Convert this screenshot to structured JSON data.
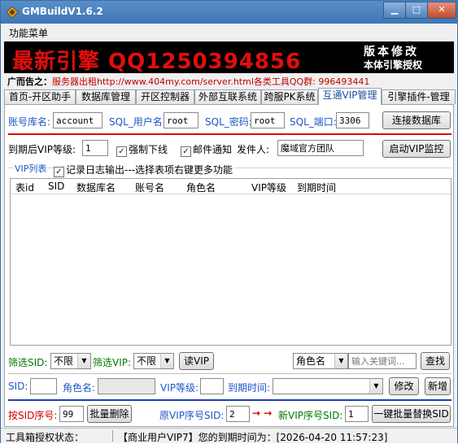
{
  "window": {
    "title": "GMBuildV1.6.2",
    "menu": "功能菜单"
  },
  "banner": {
    "left_text": "最新引擎 QQ1250394856",
    "right_line1": "版本修改",
    "right_line2": "本体引擎授权"
  },
  "ad": {
    "label": "广而告之：",
    "text": "服务器出租http://www.404my.com/server.html各类工具QQ群: 996493441"
  },
  "tabs": [
    {
      "label": "首页-开区助手"
    },
    {
      "label": "数据库管理"
    },
    {
      "label": "开区控制器"
    },
    {
      "label": "外部互联系统"
    },
    {
      "label": "跨服PK系统"
    },
    {
      "label": "互通VIP管理"
    },
    {
      "label": "引擎插件-管理"
    }
  ],
  "db": {
    "account_db_label": "账号库名:",
    "account_db_value": "account",
    "sql_user_label": "SQL_用户名:",
    "sql_user_value": "root",
    "sql_pwd_label": "SQL_密码:",
    "sql_pwd_value": "root",
    "sql_port_label": "SQL_端口:",
    "sql_port_value": "3306",
    "connect_button": "连接数据库"
  },
  "vip": {
    "expire_level_label": "到期后VIP等级:",
    "expire_level_value": "1",
    "force_offline_label": "强制下线",
    "mail_notify_label": "邮件通知",
    "sender_label": "发件人:",
    "sender_value": "魔域官方团队",
    "start_monitor_button": "启动VIP监控"
  },
  "list": {
    "group_label": "VIP列表",
    "log_checkbox_label": "记录日志输出---选择表项右键更多功能",
    "columns": [
      "表id",
      "SID",
      "数据库名",
      "账号名",
      "角色名",
      "VIP等级",
      "到期时间"
    ]
  },
  "filter": {
    "sid_label": "筛选SID:",
    "sid_value": "不限",
    "vip_label": "筛选VIP:",
    "vip_value": "不限",
    "read_button": "读VIP",
    "role_select": "角色名",
    "keyword_placeholder": "输入关键词...",
    "search_button": "查找"
  },
  "edit": {
    "sid_label": "SID:",
    "sid_value": "",
    "role_label": "角色名:",
    "role_value": "",
    "level_label": "VIP等级:",
    "level_value": "",
    "expire_label": "到期时间:",
    "expire_value": "",
    "modify_button": "修改",
    "add_button": "新增"
  },
  "batch": {
    "sid_seq_label": "按SID序号:",
    "sid_seq_value": "99",
    "batch_delete_button": "批量删除",
    "orig_sid_label": "原VIP序号SID:",
    "orig_sid_value": "2",
    "arrow": "→ →",
    "new_sid_label": "新VIP序号SID:",
    "new_sid_value": "1",
    "replace_button": "一键批量替换SID"
  },
  "status": {
    "left": "工具箱授权状态：",
    "right": "【商业用户VIP7】您的到期时间为：[2026-04-20 11:57:23]"
  },
  "colors": {
    "title_bar": "#3d76b8",
    "banner_red": "#e40d0d",
    "label_blue": "#1e56c8",
    "label_green": "#007a00",
    "label_red": "#d00000"
  }
}
